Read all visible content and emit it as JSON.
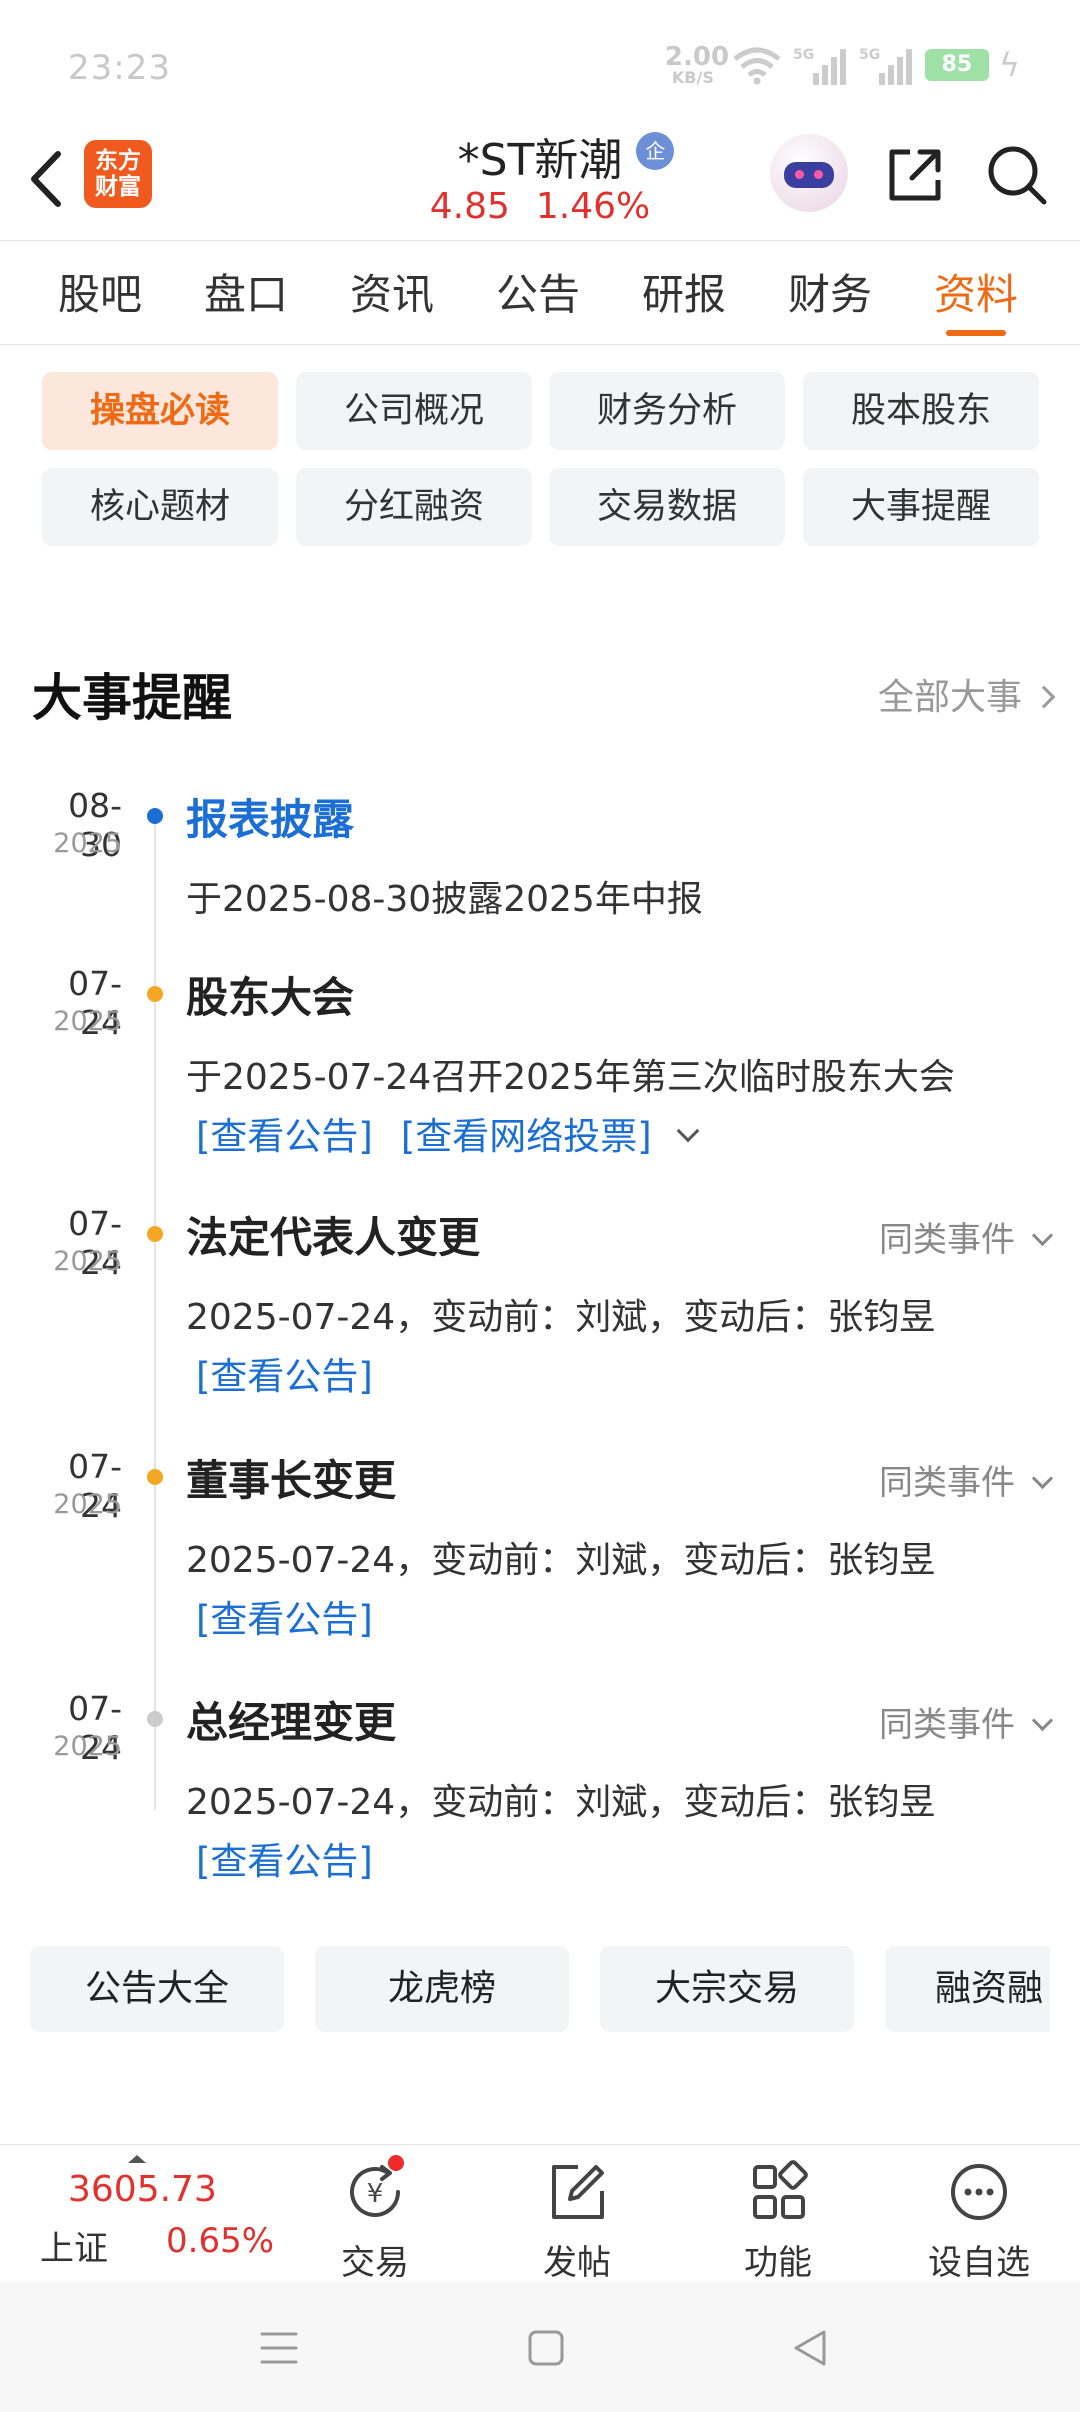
{
  "status_bar": {
    "time": "23:23",
    "net_speed_value": "2.00",
    "net_speed_unit": "KB/S",
    "signal_1": "5G",
    "signal_2": "5G",
    "battery": "85"
  },
  "header": {
    "logo_line1": "东方",
    "logo_line2": "财富",
    "stock_name": "*ST新潮",
    "badge": "企",
    "price": "4.85",
    "change_pct": "1.46%"
  },
  "tabs": [
    {
      "label": "股吧"
    },
    {
      "label": "盘口"
    },
    {
      "label": "资讯"
    },
    {
      "label": "公告"
    },
    {
      "label": "研报"
    },
    {
      "label": "财务"
    },
    {
      "label": "资料",
      "active": true
    }
  ],
  "chips": [
    {
      "label": "操盘必读",
      "active": true
    },
    {
      "label": "公司概况"
    },
    {
      "label": "财务分析"
    },
    {
      "label": "股本股东"
    },
    {
      "label": "核心题材"
    },
    {
      "label": "分红融资"
    },
    {
      "label": "交易数据"
    },
    {
      "label": "大事提醒"
    }
  ],
  "section": {
    "title": "大事提醒",
    "all_link": "全部大事"
  },
  "events": [
    {
      "date": "08-30",
      "year": "2025",
      "title": "报表披露",
      "desc": "于2025-08-30披露2025年中报",
      "dot_color": "#1b6fd4"
    },
    {
      "date": "07-24",
      "year": "2025",
      "title": "股东大会",
      "desc": "于2025-07-24召开2025年第三次临时股东大会",
      "link1": "[查看公告]",
      "link2": "[查看网络投票]",
      "dot_color": "#f5a623"
    },
    {
      "date": "07-24",
      "year": "2025",
      "title": "法定代表人变更",
      "desc": "2025-07-24，变动前：刘斌，变动后：张钧昱",
      "link1": "[查看公告]",
      "same_kind": "同类事件",
      "dot_color": "#f5a623"
    },
    {
      "date": "07-24",
      "year": "2025",
      "title": "董事长变更",
      "desc": "2025-07-24，变动前：刘斌，变动后：张钧昱",
      "link1": "[查看公告]",
      "same_kind": "同类事件",
      "dot_color": "#f5a623"
    },
    {
      "date": "07-24",
      "year": "2025",
      "title": "总经理变更",
      "desc": "2025-07-24，变动前：刘斌，变动后：张钧昱",
      "link1": "[查看公告]",
      "same_kind": "同类事件",
      "dot_color": "#cccccc"
    }
  ],
  "quick_links": [
    "公告大全",
    "龙虎榜",
    "大宗交易",
    "融资融"
  ],
  "toolbar": {
    "index_price": "3605.73",
    "index_name": "上证",
    "index_change": "0.65%",
    "trade": "交易",
    "post": "发帖",
    "functions": "功能",
    "watchlist": "设自选"
  }
}
